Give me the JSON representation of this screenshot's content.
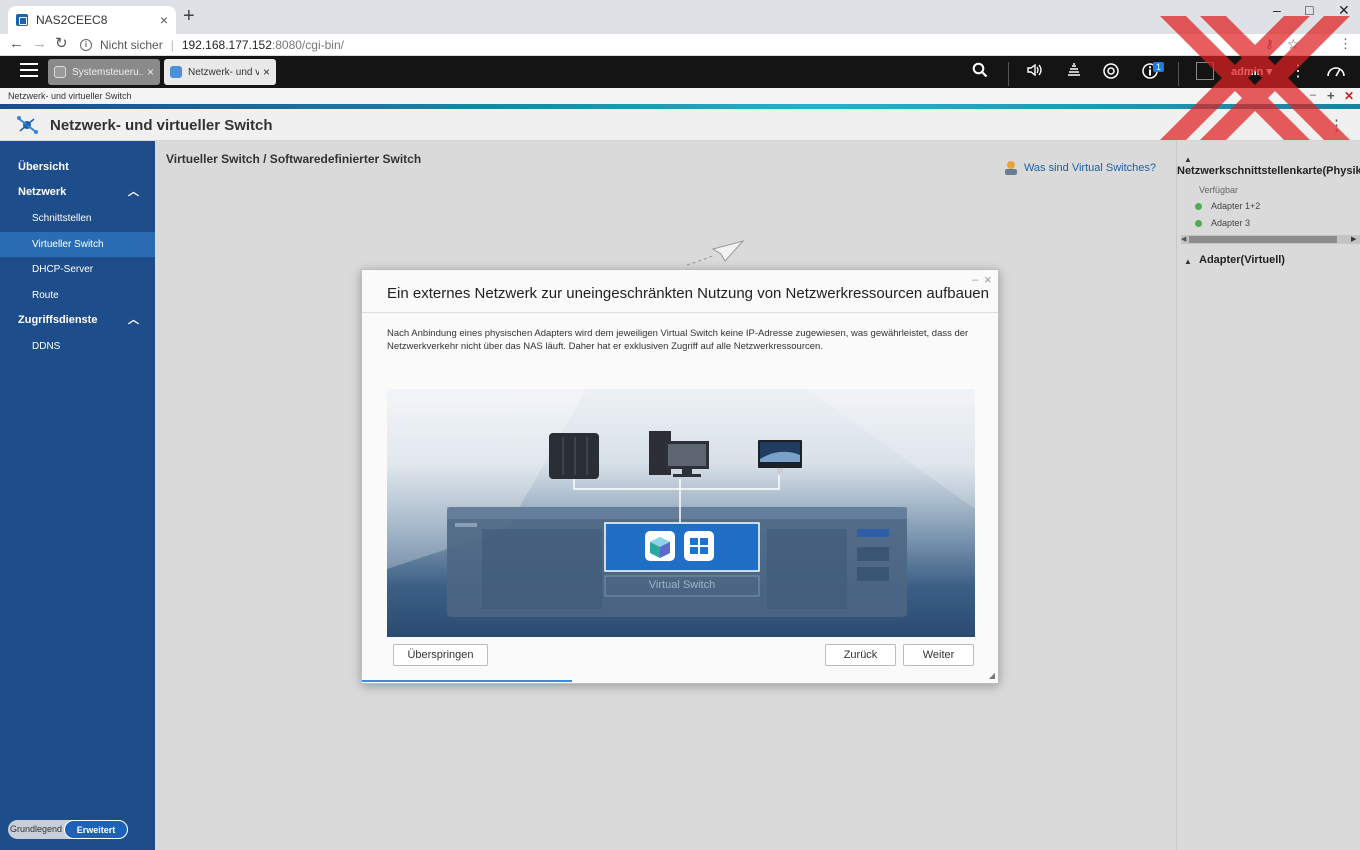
{
  "browser": {
    "tab_title": "NAS2CEEC8",
    "new_tab": "+",
    "close_tab": "×",
    "window_controls": {
      "minimize": "–",
      "maximize": "□",
      "close": "✕"
    },
    "security_label": "Nicht sicher",
    "url_host": "192.168.177.152",
    "url_path": ":8080/cgi-bin/"
  },
  "qts": {
    "app_tabs": [
      {
        "label": "Systemsteueru...",
        "close": "×"
      },
      {
        "label": "Netzwerk- und v...",
        "close": "×"
      }
    ],
    "notification_count": "1",
    "user": "admin",
    "user_caret": "▾"
  },
  "app": {
    "window_label": "Netzwerk- und virtueller Switch",
    "title": "Netzwerk- und virtueller Switch",
    "window_ctl": {
      "minimize": "–",
      "maximize": "+",
      "close": "✕"
    }
  },
  "sidebar": {
    "items": [
      {
        "label": "Übersicht"
      },
      {
        "label": "Netzwerk",
        "chevron": "︿"
      },
      {
        "label": "Schnittstellen"
      },
      {
        "label": "Virtueller Switch"
      },
      {
        "label": "DHCP-Server"
      },
      {
        "label": "Route"
      },
      {
        "label": "Zugriffsdienste",
        "chevron": "︿"
      },
      {
        "label": "DDNS"
      }
    ],
    "mode_basic": "Grundlegend",
    "mode_advanced": "Erweitert"
  },
  "main": {
    "breadcrumb": "Virtueller Switch / Softwaredefinierter Switch",
    "help_link": "Was sind Virtual Switches?"
  },
  "right_panel": {
    "nic_title": "Netzwerkschnittstellenkarte(Physikalisch)",
    "available_label": "Verfügbar",
    "adapters": [
      "Adapter 1+2",
      "Adapter 3"
    ],
    "virtual_title": "Adapter(Virtuell)",
    "caret_up": "▲",
    "scroll_left": "◀",
    "scroll_right": "▶"
  },
  "dialog": {
    "title": "Ein externes Netzwerk zur uneingeschränkten Nutzung von Netzwerkressourcen aufbauen",
    "description": "Nach Anbindung eines physischen Adapters wird dem jeweiligen Virtual Switch keine IP-Adresse zugewiesen, was gewährleistet, dass der Netzwerkverkehr nicht über das NAS läuft. Daher hat er exklusiven Zugriff auf alle Netzwerkressourcen.",
    "illustration_label": "Virtual Switch",
    "skip_button": "Überspringen",
    "back_button": "Zurück",
    "next_button": "Weiter",
    "minimize": "–",
    "close": "×",
    "resize_grip": "◢",
    "progress": 0.33
  },
  "colors": {
    "sidebar_bg": "#1e4d8c",
    "sidebar_selected": "#2a6db5",
    "qts_bar": "#141414",
    "accent": "#1c7be4",
    "status_green": "#4cae4c"
  }
}
